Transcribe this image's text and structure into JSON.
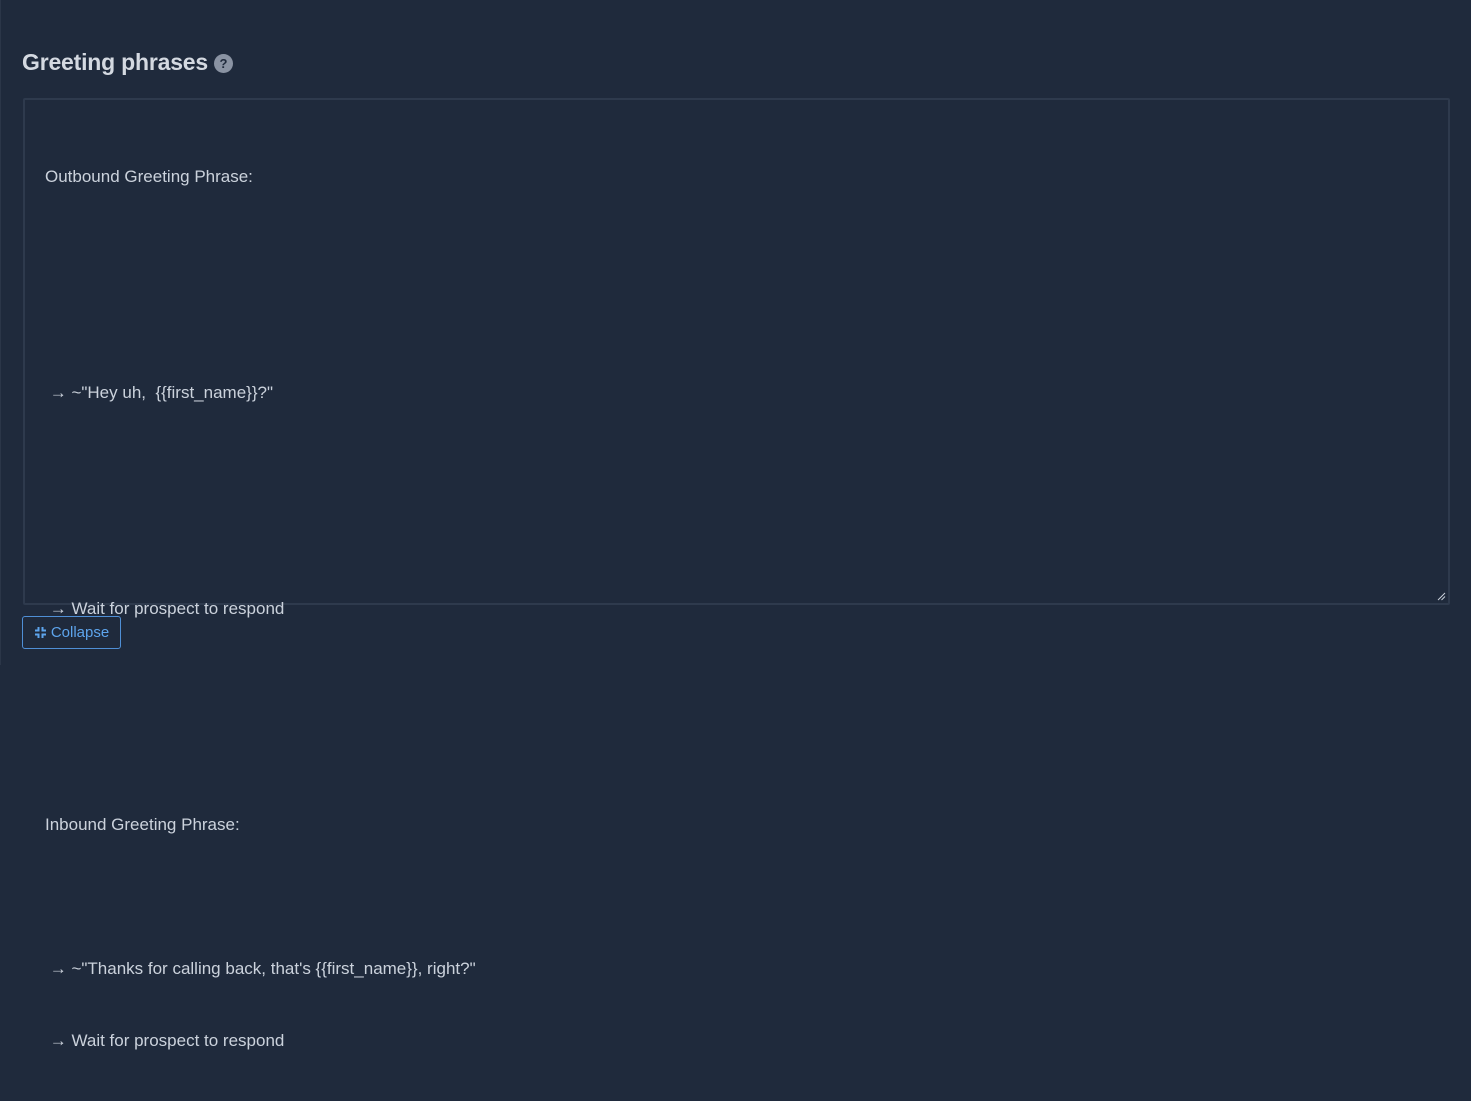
{
  "section": {
    "title": "Greeting phrases",
    "help_icon_glyph": "?"
  },
  "editor": {
    "lines": [
      "Outbound Greeting Phrase:",
      "",
      "",
      " → ~\"Hey uh,  {{first_name}}?\"",
      "",
      "",
      " → Wait for prospect to respond",
      "",
      "",
      "Inbound Greeting Phrase:",
      "",
      " → ~\"Thanks for calling back, that's {{first_name}}, right?\"",
      " → Wait for prospect to respond"
    ]
  },
  "collapse_button": {
    "label": "Collapse",
    "icon": "collapse-arrows-icon"
  },
  "colors": {
    "background": "#1f2a3c",
    "text": "#cbd2dc",
    "accent": "#5da4ec"
  }
}
